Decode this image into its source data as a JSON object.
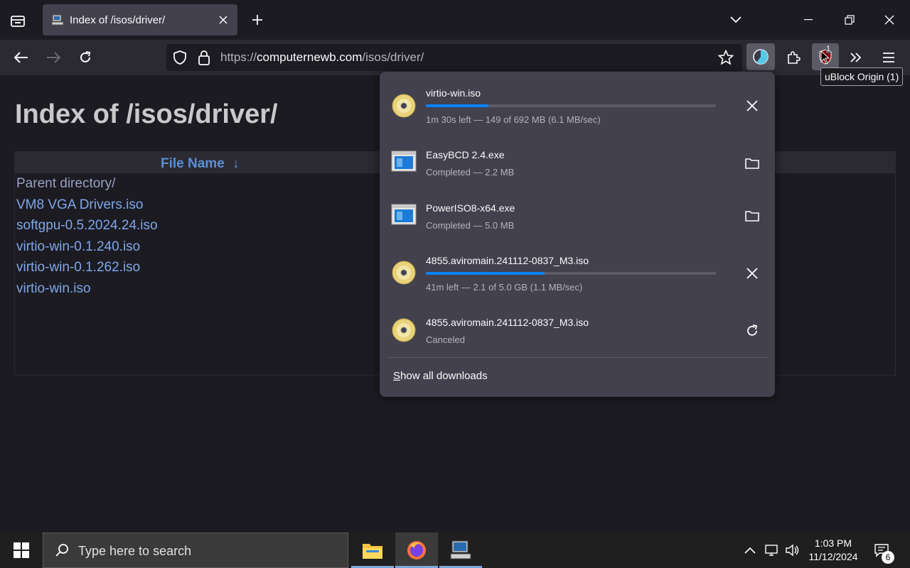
{
  "browser": {
    "tab": {
      "title": "Index of /isos/driver/"
    },
    "url": {
      "scheme": "https://",
      "host": "computernewb.com",
      "path": "/isos/driver/"
    },
    "extension_badge": "1",
    "tooltip": "uBlock Origin (1)"
  },
  "page": {
    "title": "Index of /isos/driver/",
    "table": {
      "column_header": "File Name",
      "sort_indicator": "↓",
      "rows": [
        "Parent directory/",
        "VM8 VGA Drivers.iso",
        "softgpu-0.5.2024.24.iso",
        "virtio-win-0.1.240.iso",
        "virtio-win-0.1.262.iso",
        "virtio-win.iso"
      ]
    }
  },
  "downloads": {
    "items": [
      {
        "name": "virtio-win.iso",
        "status": "1m 30s left — 149 of 692 MB (6.1 MB/sec)",
        "progress": 0.215,
        "icon": "disc-icon",
        "action": "cancel"
      },
      {
        "name": "EasyBCD 2.4.exe",
        "status": "Completed — 2.2 MB",
        "icon": "exe-icon",
        "action": "show-in-folder"
      },
      {
        "name": "PowerISO8-x64.exe",
        "status": "Completed — 5.0 MB",
        "icon": "exe-icon",
        "action": "show-in-folder"
      },
      {
        "name": "4855.aviromain.241112-0837_M3.iso",
        "status": "41m left — 2.1 of 5.0 GB (1.1 MB/sec)",
        "progress": 0.41,
        "icon": "disc-icon",
        "action": "cancel"
      },
      {
        "name": "4855.aviromain.241112-0837_M3.iso",
        "status": "Canceled",
        "icon": "disc-icon",
        "action": "retry"
      }
    ],
    "show_all_prefix": "S",
    "show_all_rest": "how all downloads"
  },
  "taskbar": {
    "search_placeholder": "Type here to search",
    "time": "1:03 PM",
    "date": "11/12/2024",
    "notification_count": "6"
  },
  "colors": {
    "accent": "#0a84ff",
    "link": "#7ea7e8",
    "panel": "#42414d"
  }
}
